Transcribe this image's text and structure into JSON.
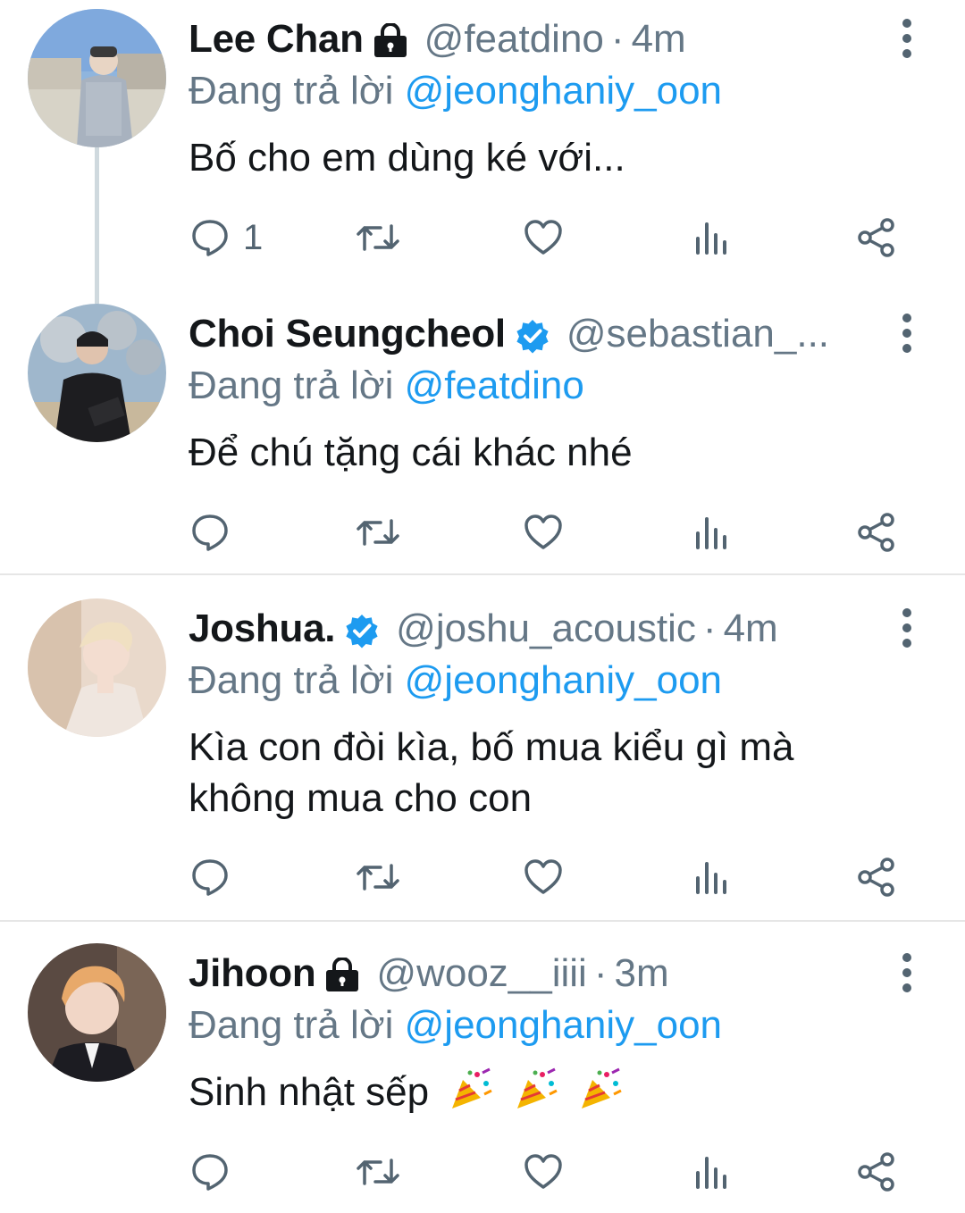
{
  "tweets": [
    {
      "name": "Lee Chan",
      "badge": "lock",
      "handle": "@featdino",
      "sep": "·",
      "time": "4m",
      "reply_prefix": "Đang trả lời",
      "reply_to": "@jeonghaniy_oon",
      "text": "Bố cho em dùng ké với...",
      "reply_count": "1"
    },
    {
      "name": "Choi Seungcheol",
      "badge": "verified",
      "handle": "@sebastian_...",
      "reply_prefix": "Đang trả lời",
      "reply_to": "@featdino",
      "text": "Để chú tặng cái khác nhé"
    },
    {
      "name": "Joshua.",
      "badge": "verified",
      "handle": "@joshu_acoustic",
      "sep": "·",
      "time": "4m",
      "reply_prefix": "Đang trả lời",
      "reply_to": "@jeonghaniy_oon",
      "text_line1": "Kìa con đòi kìa, bố mua kiểu gì mà",
      "text_line2": "không mua cho con"
    },
    {
      "name": "Jihoon",
      "badge": "lock",
      "handle": "@wooz__iiii",
      "sep": "·",
      "time": "3m",
      "reply_prefix": "Đang trả lời",
      "reply_to": "@jeonghaniy_oon",
      "text": "Sinh nhật sếp",
      "emoji": [
        "party-popper",
        "party-popper",
        "party-popper"
      ]
    }
  ],
  "colors": {
    "text": "#14171a",
    "secondary": "#657786",
    "link": "#1d9bf0",
    "verified": "#1d9bf0",
    "divider": "#e6e6e6"
  },
  "action_icons": [
    "reply-icon",
    "retweet-icon",
    "like-icon",
    "analytics-icon",
    "share-icon"
  ]
}
